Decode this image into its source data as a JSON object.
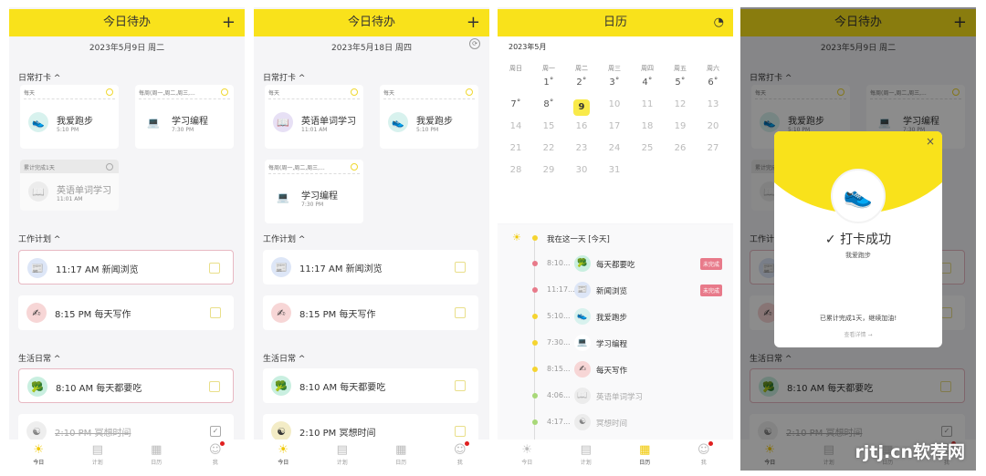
{
  "colors": {
    "accent": "#f9e21b",
    "pending_badge": "#e87a8a",
    "overdue_border": "#e8b9c3"
  },
  "nav": [
    {
      "label": "今日",
      "icon": "sun-icon"
    },
    {
      "label": "计划",
      "icon": "plan-icon"
    },
    {
      "label": "日历",
      "icon": "calendar-icon"
    },
    {
      "label": "我",
      "icon": "user-icon"
    }
  ],
  "panel1": {
    "title": "今日待办",
    "add": "+",
    "date": "2023年5月9日 周二",
    "sections": [
      "日常打卡 ^",
      "工作计划 ^",
      "生活日常 ^"
    ],
    "checkins": [
      {
        "tag": "每天",
        "name": "我爱跑步",
        "time": "5:10 PM",
        "icon": "running-shoe-icon"
      },
      {
        "tag": "每周(周一,周二,周三,...",
        "name": "学习编程",
        "time": "7:30 PM",
        "icon": "computer-icon"
      },
      {
        "tag": "累计完成1天",
        "name": "英语单词学习",
        "time": "11:01 AM",
        "icon": "book-icon",
        "done": true
      }
    ],
    "work": [
      {
        "text": "11:17 AM 新闻浏览",
        "icon": "news-icon",
        "overdue": true
      },
      {
        "text": "8:15 PM 每天写作",
        "icon": "writing-icon"
      }
    ],
    "life": [
      {
        "text": "8:10 AM 每天都要吃",
        "icon": "broccoli-icon",
        "overdue": true
      },
      {
        "text": "2:10 PM 冥想时间",
        "icon": "meditation-icon",
        "done": true
      }
    ]
  },
  "panel2": {
    "title": "今日待办",
    "add": "+",
    "date": "2023年5月18日 周四",
    "sections": [
      "日常打卡 ^",
      "工作计划 ^",
      "生活日常 ^"
    ],
    "checkins": [
      {
        "tag": "每天",
        "name": "英语单词学习",
        "time": "11:01 AM",
        "icon": "book-icon"
      },
      {
        "tag": "每天",
        "name": "我爱跑步",
        "time": "5:10 PM",
        "icon": "running-shoe-icon"
      },
      {
        "tag": "每周(周一,周二,周三,...",
        "name": "学习编程",
        "time": "7:30 PM",
        "icon": "computer-icon"
      }
    ],
    "work": [
      {
        "text": "11:17 AM 新闻浏览",
        "icon": "news-icon"
      },
      {
        "text": "8:15 PM 每天写作",
        "icon": "writing-icon"
      }
    ],
    "life": [
      {
        "text": "8:10 AM 每天都要吃",
        "icon": "broccoli-icon"
      },
      {
        "text": "2:10 PM 冥想时间",
        "icon": "meditation-icon"
      }
    ]
  },
  "calendar": {
    "title": "日历",
    "month": "2023年5月",
    "weekdays": [
      "周日",
      "周一",
      "周二",
      "周三",
      "周四",
      "周五",
      "周六"
    ],
    "first_weekday": 1,
    "days": 31,
    "selected": 9,
    "marked_days": [
      1,
      2,
      3,
      4,
      5,
      6,
      7,
      8
    ],
    "timeline_header": "我在这一天 [今天]",
    "timeline": [
      {
        "time": "8:10...",
        "name": "每天都要吃",
        "icon": "broccoli-icon",
        "status": "未完成",
        "dot": "#e87a8a"
      },
      {
        "time": "11:17...",
        "name": "新闻浏览",
        "icon": "news-icon",
        "status": "未完成",
        "dot": "#e87a8a"
      },
      {
        "time": "5:10...",
        "name": "我爱跑步",
        "icon": "running-shoe-icon",
        "dot": "#f5d430"
      },
      {
        "time": "7:30...",
        "name": "学习编程",
        "icon": "computer-icon",
        "dot": "#f5d430"
      },
      {
        "time": "8:15...",
        "name": "每天写作",
        "icon": "writing-icon",
        "dot": "#f5d430"
      },
      {
        "time": "4:06...",
        "name": "英语单词学习",
        "icon": "book-icon",
        "dot": "#a8d878",
        "done": true
      },
      {
        "time": "4:17...",
        "name": "冥想时间",
        "icon": "meditation-icon",
        "dot": "#a8d878",
        "done": true
      }
    ]
  },
  "modal": {
    "title": "打卡成功",
    "habit": "我爱跑步",
    "summary": "已累计完成1天，继续加油!",
    "link": "查看详情 →",
    "close": "×"
  },
  "watermark": "rjtj.cn软荐网"
}
